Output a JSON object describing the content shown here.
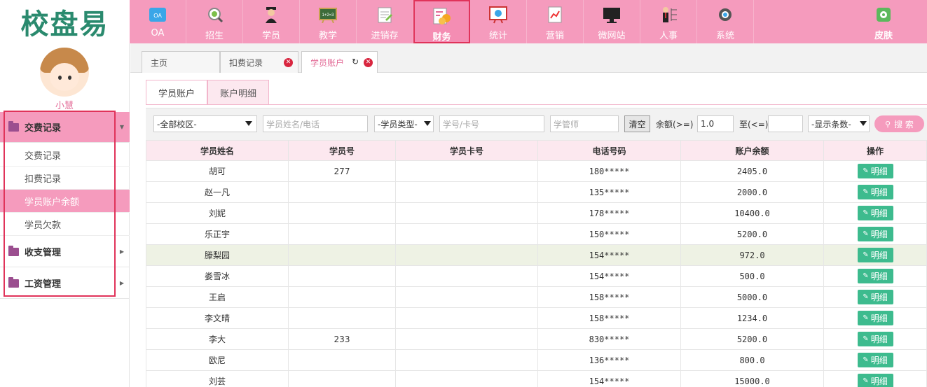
{
  "logo": {
    "text": "校盘易"
  },
  "topnav": {
    "items": [
      {
        "label": "OA",
        "icon": "oa-icon"
      },
      {
        "label": "招生",
        "icon": "recruit-icon"
      },
      {
        "label": "学员",
        "icon": "student-icon"
      },
      {
        "label": "教学",
        "icon": "teaching-icon"
      },
      {
        "label": "进销存",
        "icon": "inventory-icon"
      },
      {
        "label": "财务",
        "icon": "finance-icon",
        "active": true
      },
      {
        "label": "统计",
        "icon": "statistics-icon"
      },
      {
        "label": "营销",
        "icon": "marketing-icon"
      },
      {
        "label": "微网站",
        "icon": "microsite-icon"
      },
      {
        "label": "人事",
        "icon": "hr-icon"
      },
      {
        "label": "系统",
        "icon": "system-gear-icon"
      }
    ],
    "skin_label": "皮肤"
  },
  "sidebar": {
    "username": "小慧",
    "groups": [
      {
        "label": "交费记录",
        "open": true,
        "items": [
          "交费记录",
          "扣费记录",
          "学员账户余额",
          "学员欠款"
        ],
        "active_item": 2
      },
      {
        "label": "收支管理",
        "open": false
      },
      {
        "label": "工资管理",
        "open": false
      }
    ]
  },
  "tabs": [
    {
      "label": "主页"
    },
    {
      "label": "扣费记录"
    },
    {
      "label": "学员账户",
      "active": true
    }
  ],
  "subtabs": [
    "学员账户",
    "账户明细"
  ],
  "filters": {
    "campus": "-全部校区-",
    "name_phone_placeholder": "学员姓名/电话",
    "student_type": "-学员类型-",
    "id_card_placeholder": "学号/卡号",
    "manager_placeholder": "学管师",
    "clear_label": "清空",
    "balance_ge_label": "余额(>=)",
    "balance_ge_value": "1.0",
    "balance_le_label": "至(<=)",
    "balance_le_value": "",
    "page_size": "-显示条数-",
    "search_label": "搜 索"
  },
  "table": {
    "headers": [
      "学员姓名",
      "学员号",
      "学员卡号",
      "电话号码",
      "账户余额",
      "操作"
    ],
    "action_label": "明细",
    "rows": [
      {
        "name": "胡可",
        "no": "277",
        "card": "",
        "phone": "180*****",
        "balance": "2405.0"
      },
      {
        "name": "赵一凡",
        "no": "",
        "card": "",
        "phone": "135*****",
        "balance": "2000.0"
      },
      {
        "name": "刘妮",
        "no": "",
        "card": "",
        "phone": "178*****",
        "balance": "10400.0"
      },
      {
        "name": "乐正宇",
        "no": "",
        "card": "",
        "phone": "150*****",
        "balance": "5200.0"
      },
      {
        "name": "滕梨园",
        "no": "",
        "card": "",
        "phone": "154*****",
        "balance": "972.0"
      },
      {
        "name": "娄雪冰",
        "no": "",
        "card": "",
        "phone": "154*****",
        "balance": "500.0"
      },
      {
        "name": "王启",
        "no": "",
        "card": "",
        "phone": "158*****",
        "balance": "5000.0"
      },
      {
        "name": "李文晴",
        "no": "",
        "card": "",
        "phone": "158*****",
        "balance": "1234.0"
      },
      {
        "name": "李大",
        "no": "233",
        "card": "",
        "phone": "830*****",
        "balance": "5200.0"
      },
      {
        "name": "欧尼",
        "no": "",
        "card": "",
        "phone": "136*****",
        "balance": "800.0"
      },
      {
        "name": "刘芸",
        "no": "",
        "card": "",
        "phone": "154*****",
        "balance": "15000.0"
      }
    ],
    "highlight_row": 4
  }
}
